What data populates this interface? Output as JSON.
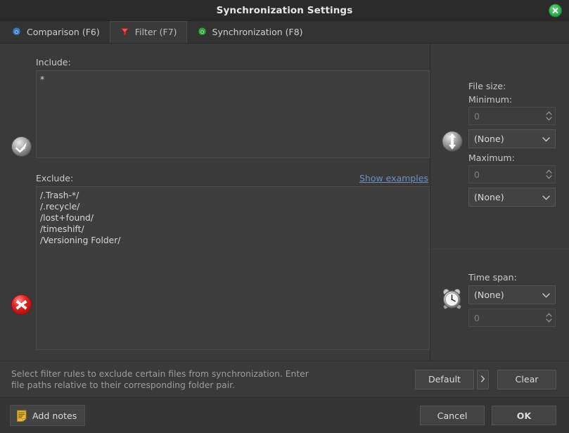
{
  "window": {
    "title": "Synchronization Settings",
    "close_icon": "close-circle-icon"
  },
  "tabs": [
    {
      "label": "Comparison (F6)",
      "icon": "blue-gear-icon",
      "active": false
    },
    {
      "label": "Filter (F7)",
      "icon": "red-funnel-icon",
      "active": true
    },
    {
      "label": "Synchronization (F8)",
      "icon": "green-gear-icon",
      "active": false
    }
  ],
  "filter": {
    "include": {
      "label": "Include:",
      "icon": "check-circle-icon",
      "value": "*"
    },
    "exclude": {
      "label": "Exclude:",
      "icon": "red-x-circle-icon",
      "show_examples_label": "Show examples",
      "value": "/.Trash-*/\n/.recycle/\n/lost+found/\n/timeshift/\n/Versioning Folder/"
    }
  },
  "file_size": {
    "group_label": "File size:",
    "icon": "up-down-arrow-icon",
    "minimum_label": "Minimum:",
    "minimum_value": "0",
    "minimum_unit": "(None)",
    "maximum_label": "Maximum:",
    "maximum_value": "0",
    "maximum_unit": "(None)"
  },
  "time_span": {
    "label": "Time span:",
    "icon": "alarm-clock-icon",
    "unit": "(None)",
    "value": "0"
  },
  "status": {
    "text": "Select filter rules to exclude certain files from synchronization. Enter\nfile paths relative to their corresponding folder pair."
  },
  "actions": {
    "default_label": "Default",
    "default_arrow_icon": "chevron-right-icon",
    "clear_label": "Clear"
  },
  "footer": {
    "add_notes_label": "Add notes",
    "add_notes_icon": "note-icon",
    "cancel_label": "Cancel",
    "ok_label": "OK"
  },
  "colors": {
    "window_bg": "#3a3a3a",
    "titlebar_bg": "#2b2b2b",
    "accent_link": "#6f8fc4",
    "close_green": "#2fb34f",
    "error_red": "#e03131",
    "note_yellow": "#e8b93a"
  }
}
